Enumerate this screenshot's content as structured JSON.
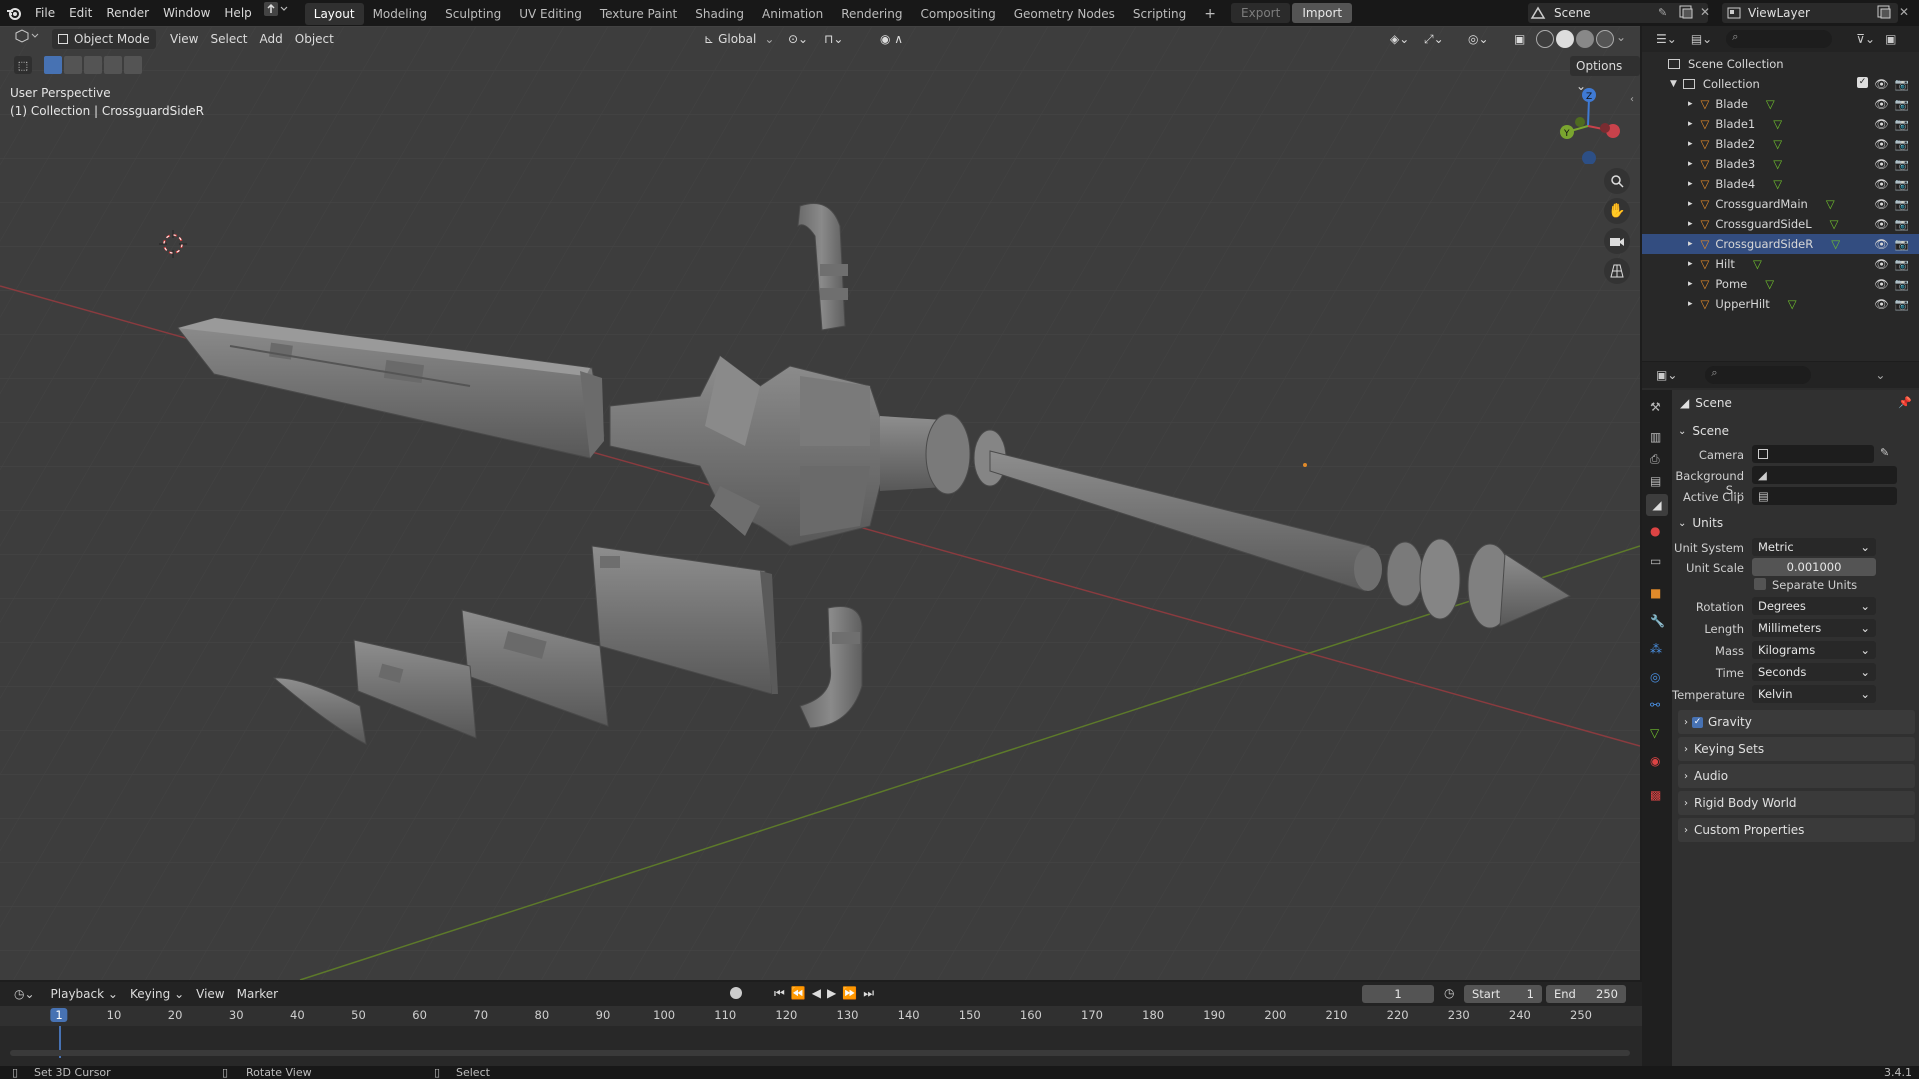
{
  "topbar": {
    "menus": [
      "File",
      "Edit",
      "Render",
      "Window",
      "Help"
    ],
    "workspaces": [
      "Layout",
      "Modeling",
      "Sculpting",
      "UV Editing",
      "Texture Paint",
      "Shading",
      "Animation",
      "Rendering",
      "Compositing",
      "Geometry Nodes",
      "Scripting"
    ],
    "active_workspace": "Layout",
    "export_label": "Export",
    "import_label": "Import",
    "scene_name": "Scene",
    "view_layer": "ViewLayer"
  },
  "viewport": {
    "mode": "Object Mode",
    "menus": [
      "View",
      "Select",
      "Add",
      "Object"
    ],
    "transform_orientation": "Global",
    "options_label": "Options",
    "perspective_label": "User Perspective",
    "context_label": "(1) Collection | CrossguardSideR"
  },
  "outliner": {
    "root": "Scene Collection",
    "collection": "Collection",
    "objects": [
      "Blade",
      "Blade1",
      "Blade2",
      "Blade3",
      "Blade4",
      "CrossguardMain",
      "CrossguardSideL",
      "CrossguardSideR",
      "Hilt",
      "Pome",
      "UpperHilt"
    ],
    "selected": "CrossguardSideR"
  },
  "properties": {
    "context": "Scene",
    "scene_panel": {
      "title": "Scene",
      "camera_label": "Camera",
      "background_label": "Background S...",
      "active_clip_label": "Active Clip"
    },
    "units_panel": {
      "title": "Units",
      "unit_system_label": "Unit System",
      "unit_system": "Metric",
      "unit_scale_label": "Unit Scale",
      "unit_scale": "0.001000",
      "separate_units": "Separate Units",
      "rotation_label": "Rotation",
      "rotation": "Degrees",
      "length_label": "Length",
      "length": "Millimeters",
      "mass_label": "Mass",
      "mass": "Kilograms",
      "time_label": "Time",
      "time": "Seconds",
      "temperature_label": "Temperature",
      "temperature": "Kelvin"
    },
    "collapsed_panels": [
      "Gravity",
      "Keying Sets",
      "Audio",
      "Rigid Body World",
      "Custom Properties"
    ]
  },
  "timeline": {
    "menus": [
      "Playback",
      "Keying",
      "View",
      "Marker"
    ],
    "current_frame": "1",
    "start_label": "Start",
    "start": "1",
    "end_label": "End",
    "end": "250",
    "ruler_frames": [
      "1",
      "10",
      "20",
      "30",
      "40",
      "50",
      "60",
      "70",
      "80",
      "90",
      "100",
      "110",
      "120",
      "130",
      "140",
      "150",
      "160",
      "170",
      "180",
      "190",
      "200",
      "210",
      "220",
      "230",
      "240",
      "250"
    ]
  },
  "statusbar": {
    "left": "Set 3D Cursor",
    "middle": "Rotate View",
    "right": "Select",
    "version": "3.4.1"
  },
  "colors": {
    "accent": "#4772b3",
    "selected_row": "#334d80",
    "viewport_bg": "#3d3d3d",
    "x_axis": "#c8424b",
    "y_axis": "#7aa52f",
    "z_axis": "#3f7ad4"
  }
}
